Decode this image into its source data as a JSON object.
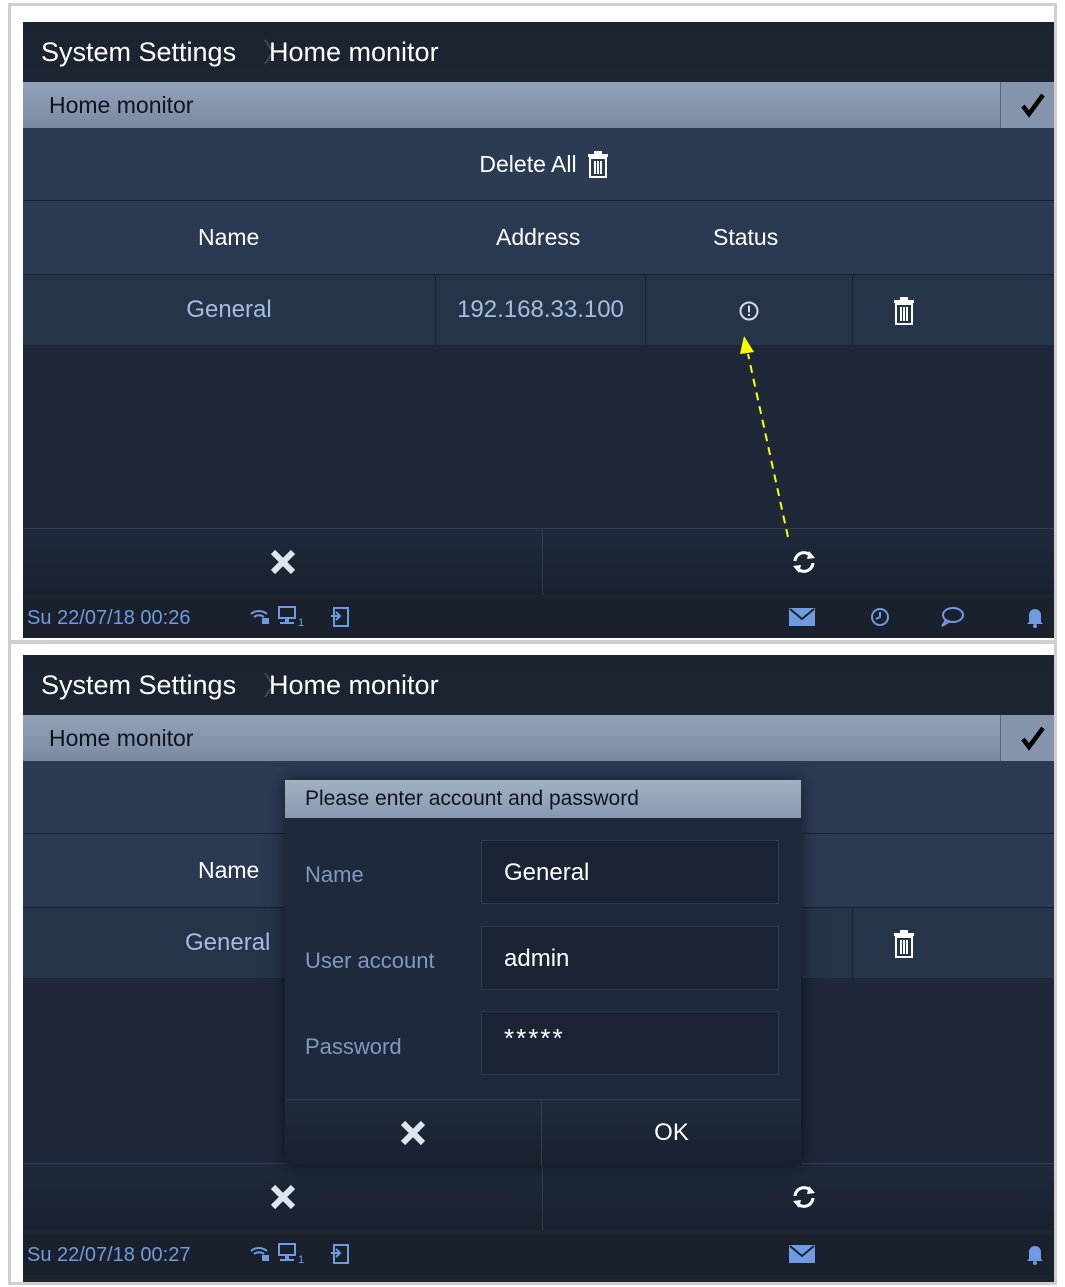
{
  "screen1": {
    "breadcrumb": {
      "parent": "System Settings",
      "current": "Home monitor"
    },
    "header_title": "Home monitor",
    "delete_all_label": "Delete All",
    "columns": {
      "name": "Name",
      "address": "Address",
      "status": "Status"
    },
    "row": {
      "name": "General",
      "address": "192.168.33.100"
    },
    "status_bar": {
      "datetime": "Su 22/07/18  00:26"
    }
  },
  "screen2": {
    "breadcrumb": {
      "parent": "System Settings",
      "current": "Home monitor"
    },
    "header_title": "Home monitor",
    "columns": {
      "name": "Name"
    },
    "row": {
      "name": "General"
    },
    "dialog": {
      "title": "Please enter account and password",
      "name_label": "Name",
      "name_value": "General",
      "account_label": "User account",
      "account_value": "admin",
      "password_label": "Password",
      "password_value": "*****",
      "ok_label": "OK"
    },
    "status_bar": {
      "datetime": "Su 22/07/18  00:27"
    }
  },
  "colors": {
    "accent_blue": "#6f9be0",
    "arrow_yellow": "#ffff00",
    "header_bar": "#8595ad"
  }
}
